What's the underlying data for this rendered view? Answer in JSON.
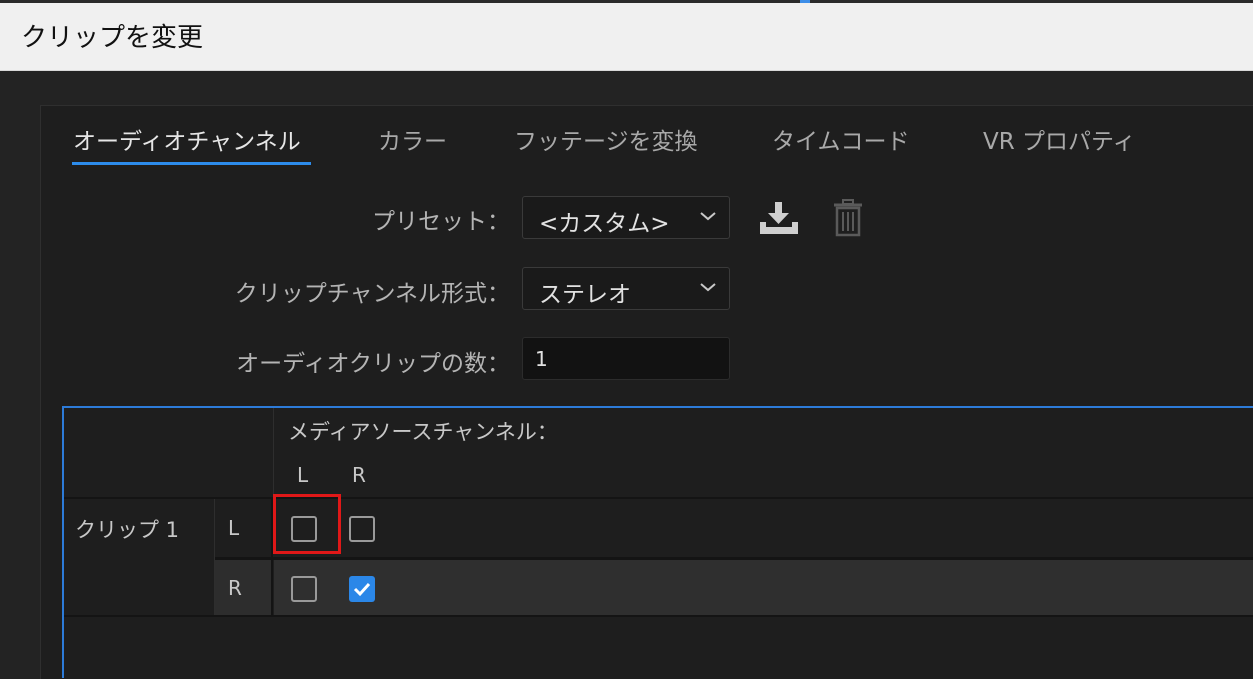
{
  "window": {
    "title": "クリップを変更"
  },
  "tabs": [
    {
      "label": "オーディオチャンネル",
      "active": true
    },
    {
      "label": "カラー",
      "active": false
    },
    {
      "label": "フッテージを変換",
      "active": false
    },
    {
      "label": "タイムコード",
      "active": false
    },
    {
      "label": "VR プロパティ",
      "active": false
    }
  ],
  "preset": {
    "label": "プリセット：",
    "value": "<カスタム>"
  },
  "clip_channel_format": {
    "label": "クリップチャンネル形式：",
    "value": "ステレオ"
  },
  "audio_clip_count": {
    "label": "オーディオクリップの数：",
    "value": "1"
  },
  "mapping": {
    "media_source_label": "メディアソースチャンネル：",
    "columns": [
      "L",
      "R"
    ],
    "clip_name": "クリップ 1",
    "rows": [
      {
        "channel": "L",
        "checks": [
          false,
          false
        ]
      },
      {
        "channel": "R",
        "checks": [
          false,
          true
        ]
      }
    ]
  },
  "colors": {
    "accent": "#2d8ceb",
    "highlight": "#e01818",
    "checkbox_checked": "#2b87e8"
  },
  "icons": {
    "save_preset": "download-tray-icon",
    "delete_preset": "trash-icon",
    "dropdown": "chevron-down-icon"
  }
}
